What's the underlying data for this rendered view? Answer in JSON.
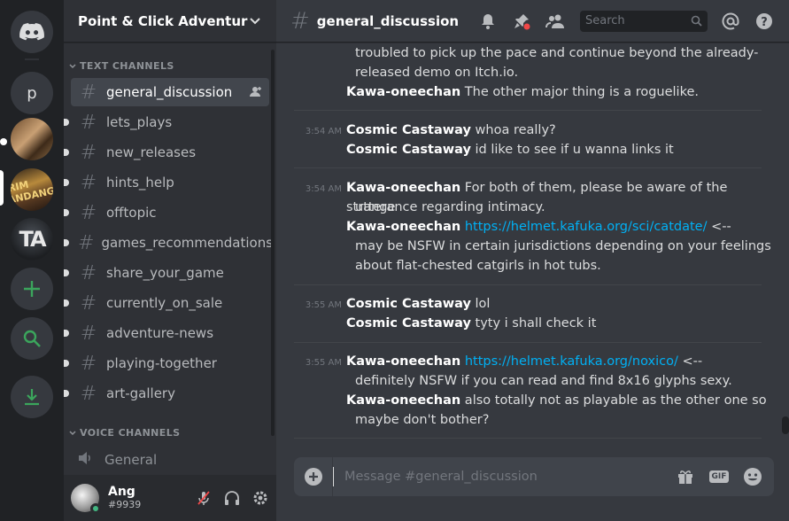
{
  "guild": {
    "name": "Point & Click Adventure ...",
    "servers": [
      {
        "label": "p"
      },
      {
        "label": "GRIM FANDANGO"
      },
      {
        "label": "TA"
      }
    ]
  },
  "sidebar": {
    "text_category": "TEXT CHANNELS",
    "voice_category": "VOICE CHANNELS",
    "channels": [
      {
        "name": "general_discussion"
      },
      {
        "name": "lets_plays"
      },
      {
        "name": "new_releases"
      },
      {
        "name": "hints_help"
      },
      {
        "name": "offtopic"
      },
      {
        "name": "games_recommendations"
      },
      {
        "name": "share_your_game"
      },
      {
        "name": "currently_on_sale"
      },
      {
        "name": "adventure-news"
      },
      {
        "name": "playing-together"
      },
      {
        "name": "art-gallery"
      }
    ],
    "voice_channels": [
      {
        "name": "General"
      }
    ]
  },
  "user": {
    "name": "Ang",
    "tag": "#9939"
  },
  "topbar": {
    "channel": "general_discussion",
    "search_placeholder": "Search"
  },
  "messages": {
    "g0": {
      "l1": "troubled to pick up the pace and continue beyond the already-",
      "l2": "released demo on Itch.io.",
      "l3_author": "Kawa-oneechan",
      "l3_text": " The other major thing is a roguelike."
    },
    "g1": {
      "ts": "3:54 AM",
      "l1_author": "Cosmic Castaway",
      "l1_text": " whoa really?",
      "l2_author": "Cosmic Castaway",
      "l2_text": " id like to see if u wanna links it"
    },
    "g2": {
      "ts": "3:54 AM",
      "l1_author": "Kawa-oneechan",
      "l1_text": " For both of them, please be aware of the strange",
      "l2": "utterance regarding intimacy.",
      "l3_author": "Kawa-oneechan",
      "l3_link": "https://helmet.kafuka.org/sci/catdate/",
      "l3_text": " <--",
      "l4": "may be NSFW in certain jurisdictions depending on your feelings",
      "l5": "about flat-chested catgirls in hot tubs."
    },
    "g3": {
      "ts": "3:55 AM",
      "l1_author": "Cosmic Castaway",
      "l1_text": " lol",
      "l2_author": "Cosmic Castaway",
      "l2_text": " tyty i shall check it"
    },
    "g4": {
      "ts": "3:55 AM",
      "l1_author": "Kawa-oneechan",
      "l1_link": "https://helmet.kafuka.org/noxico/",
      "l1_text": " <--",
      "l2": "definitely NSFW if you can read and find 8x16 glyphs sexy.",
      "l3_author": "Kawa-oneechan",
      "l3_text": " also totally not as playable as the other one so",
      "l4": "maybe don't bother?"
    }
  },
  "composer": {
    "placeholder": "Message #general_discussion",
    "gif_label": "GIF"
  },
  "colors": {
    "accent": "#7289da",
    "link": "#00b0f4",
    "online": "#43b581",
    "green": "#3ba55c"
  }
}
